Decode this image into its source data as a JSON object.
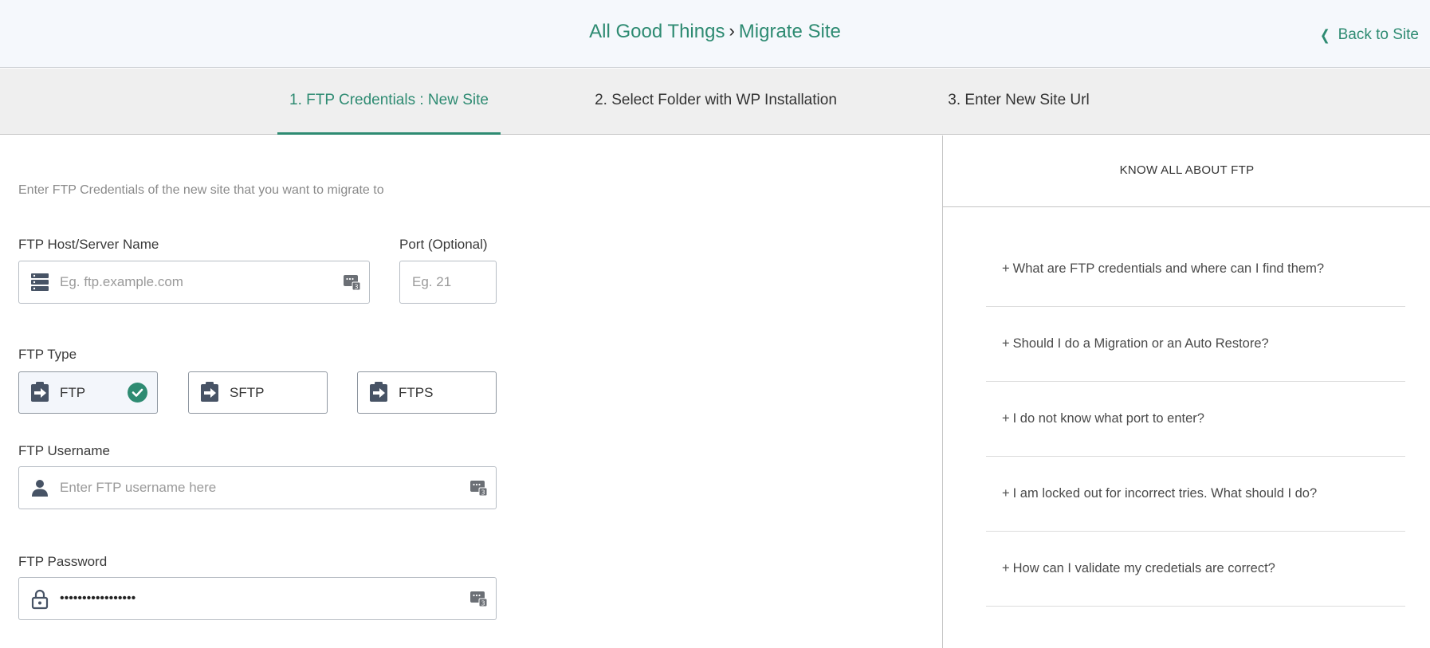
{
  "header": {
    "crumb_parent": "All Good Things",
    "crumb_separator": "›",
    "crumb_current": "Migrate Site",
    "back_label": "Back to Site"
  },
  "steps": [
    {
      "label": "1. FTP Credentials : New Site",
      "active": true
    },
    {
      "label": "2. Select Folder with WP Installation",
      "active": false
    },
    {
      "label": "3. Enter New Site Url",
      "active": false
    }
  ],
  "form": {
    "intro": "Enter FTP Credentials of the new site that you want to migrate to",
    "host_label": "FTP Host/Server Name",
    "host_placeholder": "Eg. ftp.example.com",
    "port_label": "Port (Optional)",
    "port_placeholder": "Eg. 21",
    "type_label": "FTP Type",
    "types": [
      "FTP",
      "SFTP",
      "FTPS"
    ],
    "selected_type": "FTP",
    "username_label": "FTP Username",
    "username_placeholder": "Enter FTP username here",
    "password_label": "FTP Password",
    "password_value": "•••••••••••••••••"
  },
  "help": {
    "title": "KNOW ALL ABOUT FTP",
    "items": [
      "What are FTP credentials and where can I find them?",
      "Should I do a Migration or an Auto Restore?",
      "I do not know what port to enter?",
      "I am locked out for incorrect tries. What should I do?",
      "How can I validate my credetials are correct?"
    ]
  },
  "colors": {
    "accent": "#2e8b72",
    "header_bg": "#f5f8fc",
    "steps_bg": "#efefef",
    "icon": "#475365"
  },
  "icons": {
    "host": "server-icon",
    "username": "user-icon",
    "password": "lock-icon",
    "type": "clipboard-arrow-icon",
    "badge": "password-manager-icon",
    "selected": "check-circle-icon",
    "back": "chevron-left-icon",
    "faq": "plus-icon"
  }
}
